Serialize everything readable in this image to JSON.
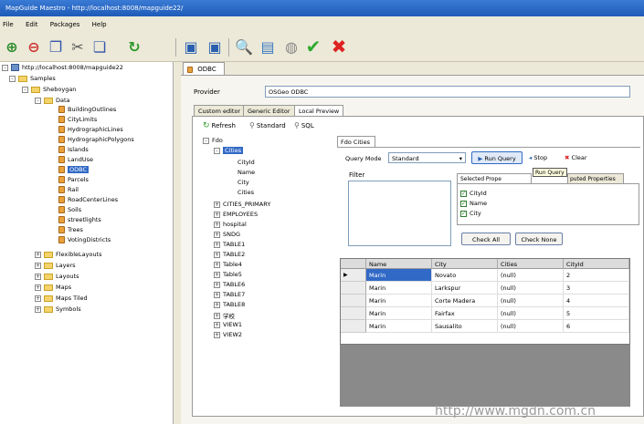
{
  "window": {
    "title": "MapGuide Maestro - http://localhost:8008/mapguide22/"
  },
  "menu": [
    "File",
    "Edit",
    "Packages",
    "Help"
  ],
  "tree": {
    "root": "http://localhost:8008/mapguide22",
    "samples": "Samples",
    "sheboygan": "Sheboygan",
    "data": "Data",
    "data_items": [
      "BuildingOutlines",
      "CityLimits",
      "HydrographicLines",
      "HydrographicPolygons",
      "Islands",
      "LandUse",
      "ODBC",
      "Parcels",
      "Rail",
      "RoadCenterLines",
      "Soils",
      "streetlights",
      "Trees",
      "VotingDistricts"
    ],
    "selected": "ODBC",
    "folders": [
      "FlexibleLayouts",
      "Layers",
      "Layouts",
      "Maps",
      "Maps Tiled",
      "Symbols"
    ]
  },
  "doc_tab": "ODBC",
  "provider": {
    "label": "Provider",
    "value": "OSGeo ODBC"
  },
  "subtabs": [
    "Custom editor",
    "Generic Editor",
    "Local Preview"
  ],
  "preview_toolbar": {
    "refresh": "Refresh",
    "standard": "Standard",
    "sql": "SQL"
  },
  "schema_tree": {
    "root": "Fdo",
    "selected": "Cities",
    "fields": [
      "CityId",
      "Name",
      "City",
      "Cities"
    ],
    "classes": [
      "CITIES_PRIMARY",
      "EMPLOYEES",
      "hospital",
      "SNDG",
      "TABLE1",
      "TABLE2",
      "Table4",
      "Table5",
      "TABLE6",
      "TABLE7",
      "TABLE8",
      "学校",
      "VIEW1",
      "VIEW2"
    ]
  },
  "query_tab": "Fdo Cities",
  "query_mode": {
    "label": "Query Mode",
    "value": "Standard"
  },
  "run_query": "Run Query",
  "stop": "Stop",
  "clear": "Clear",
  "tooltip": "Run Query",
  "filter_label": "Filter",
  "props_tabs": {
    "selected": "Selected Prope",
    "computed": "puted Properties"
  },
  "props": [
    "CityId",
    "Name",
    "City"
  ],
  "check_all": "Check All",
  "check_none": "Check None",
  "grid": {
    "columns": [
      "Name",
      "City",
      "Cities",
      "CityId"
    ],
    "rows": [
      [
        "Marin",
        "Novato",
        "(null)",
        "2"
      ],
      [
        "Marin",
        "Larkspur",
        "(null)",
        "3"
      ],
      [
        "Marin",
        "Corte Madera",
        "(null)",
        "4"
      ],
      [
        "Marin",
        "Fairfax",
        "(null)",
        "5"
      ],
      [
        "Marin",
        "Sausalito",
        "(null)",
        "6"
      ]
    ]
  },
  "watermark": "http://www.mgdn.com.cn"
}
